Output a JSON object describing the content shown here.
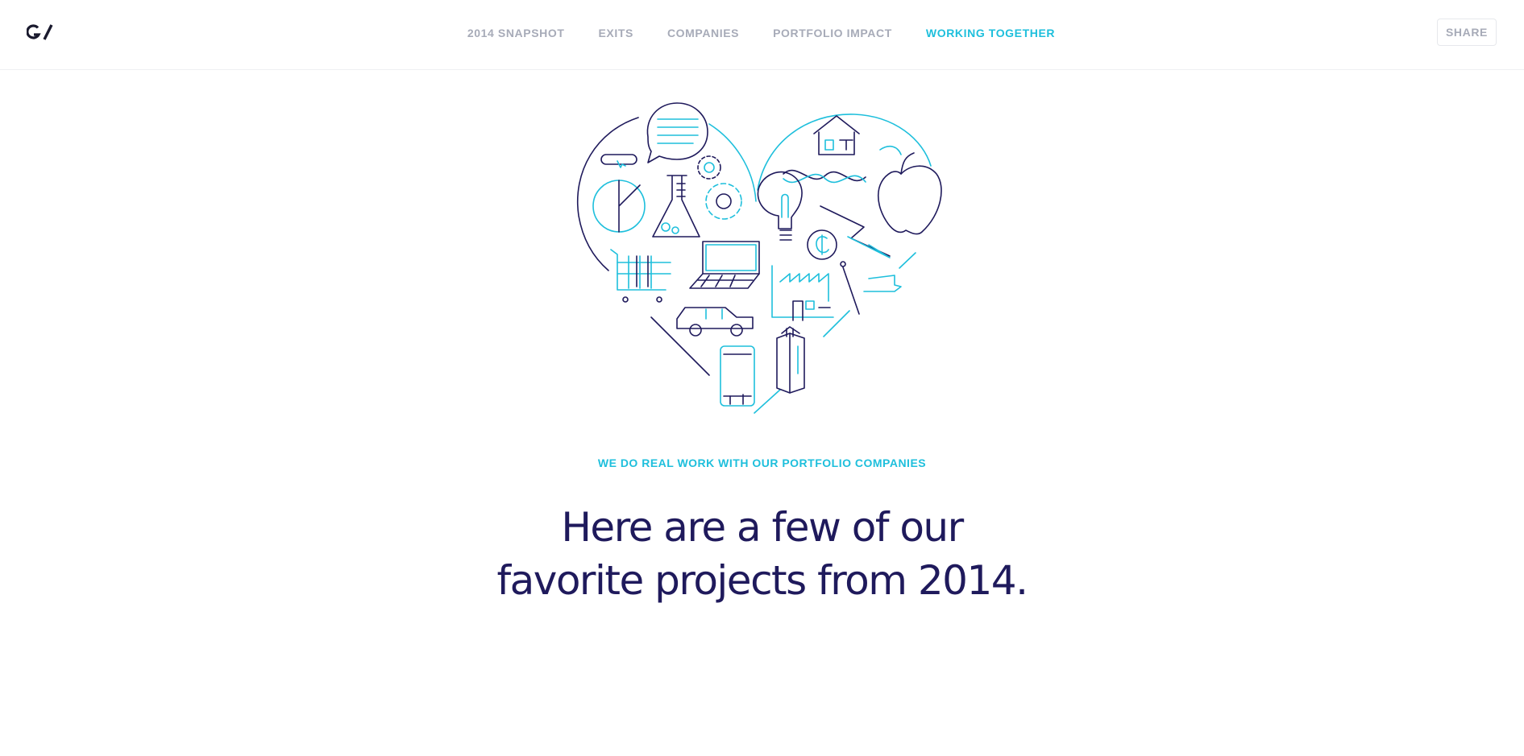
{
  "logo": {
    "text": "G/"
  },
  "nav": {
    "items": [
      {
        "label": "2014 SNAPSHOT",
        "active": false
      },
      {
        "label": "EXITS",
        "active": false
      },
      {
        "label": "COMPANIES",
        "active": false
      },
      {
        "label": "PORTFOLIO IMPACT",
        "active": false
      },
      {
        "label": "WORKING TOGETHER",
        "active": true
      }
    ]
  },
  "share": {
    "label": "SHARE"
  },
  "hero": {
    "eyebrow": "WE DO REAL WORK WITH OUR PORTFOLIO COMPANIES",
    "headline_line1": "Here are a few of our",
    "headline_line2": "favorite projects from 2014."
  },
  "colors": {
    "accent": "#1ebfdc",
    "navy": "#1f1a5c",
    "nav_gray": "#a7abb8"
  },
  "illustration": {
    "icons": [
      "chat-bubble-icon",
      "toggle-icon",
      "pie-chart-icon",
      "flask-icon",
      "gear-icon",
      "shopping-cart-icon",
      "laptop-icon",
      "car-icon",
      "phone-icon",
      "book-icon",
      "house-icon",
      "dna-icon",
      "lightbulb-icon",
      "coin-icon",
      "paper-plane-icon",
      "apple-icon",
      "factory-icon",
      "microscope-icon"
    ]
  }
}
